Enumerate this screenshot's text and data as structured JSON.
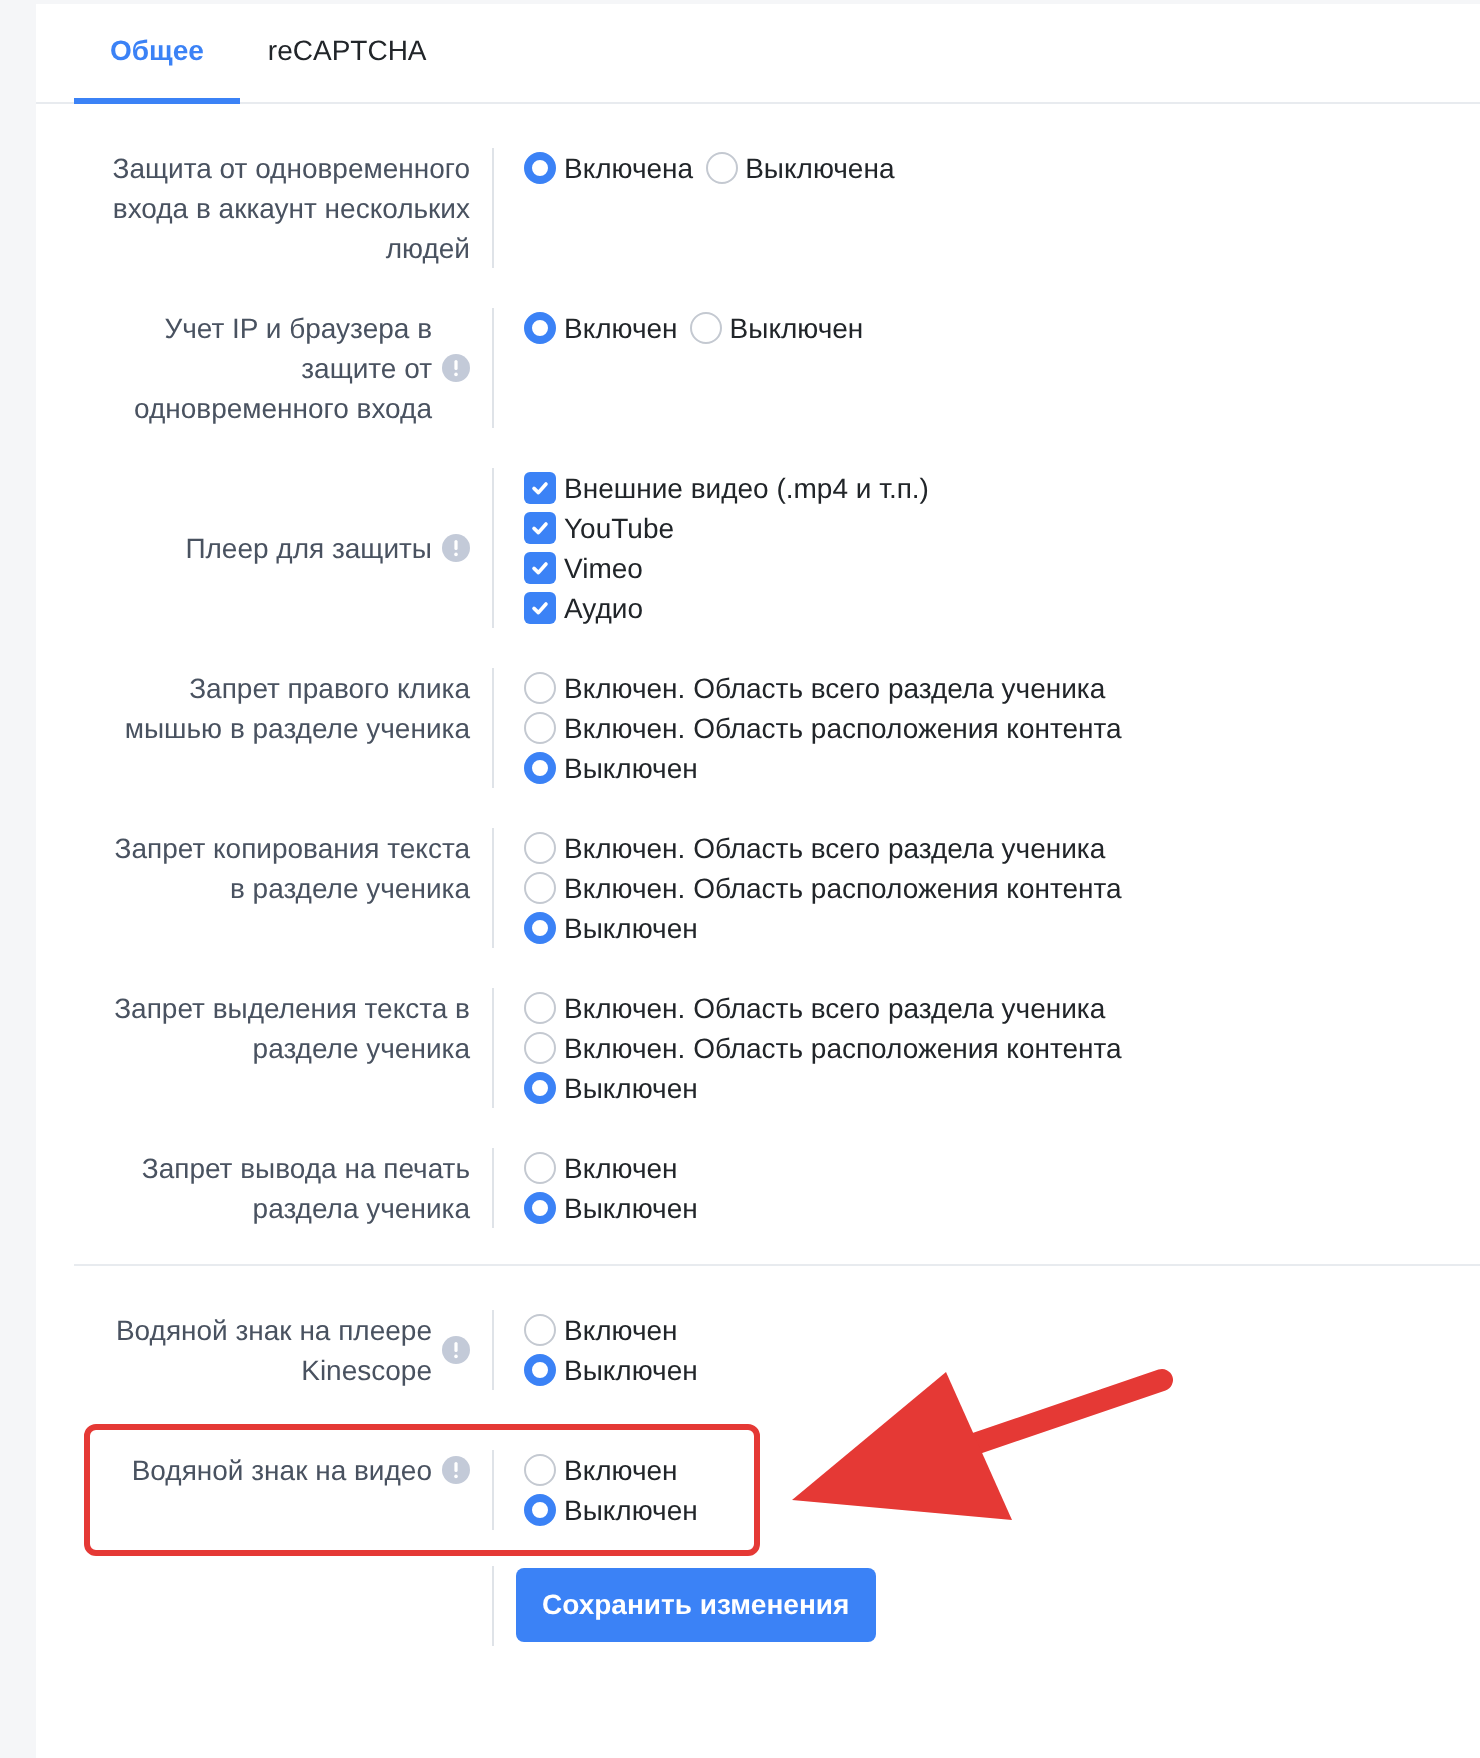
{
  "tabs": [
    {
      "label": "Общее",
      "selected": true
    },
    {
      "label": "reCAPTCHA",
      "selected": false
    }
  ],
  "sections": [
    {
      "rows": [
        {
          "label": "Защита от одновременного входа в аккаунт нескольких людей",
          "info": false,
          "kind": "radio",
          "inline": true,
          "highlighted": false,
          "options": [
            {
              "label": "Включена",
              "selected": true
            },
            {
              "label": "Выключена",
              "selected": false
            }
          ]
        },
        {
          "label": "Учет IP и браузера в защите от одновременного входа",
          "info": true,
          "kind": "radio",
          "inline": true,
          "highlighted": false,
          "options": [
            {
              "label": "Включен",
              "selected": true
            },
            {
              "label": "Выключен",
              "selected": false
            }
          ]
        },
        {
          "label": "Плеер для защиты",
          "info": true,
          "kind": "checkbox",
          "inline": false,
          "highlighted": false,
          "options": [
            {
              "label": "Внешние видео (.mp4 и т.п.)",
              "checked": true
            },
            {
              "label": "YouTube",
              "checked": true
            },
            {
              "label": "Vimeo",
              "checked": true
            },
            {
              "label": "Аудио",
              "checked": true
            }
          ]
        },
        {
          "label": "Запрет правого клика мышью в разделе ученика",
          "info": false,
          "kind": "radio",
          "inline": false,
          "highlighted": false,
          "options": [
            {
              "label": "Включен. Область всего раздела ученика",
              "selected": false
            },
            {
              "label": "Включен. Область расположения контента",
              "selected": false
            },
            {
              "label": "Выключен",
              "selected": true
            }
          ]
        },
        {
          "label": "Запрет копирования текста в разделе ученика",
          "info": false,
          "kind": "radio",
          "inline": false,
          "highlighted": false,
          "options": [
            {
              "label": "Включен. Область всего раздела ученика",
              "selected": false
            },
            {
              "label": "Включен. Область расположения контента",
              "selected": false
            },
            {
              "label": "Выключен",
              "selected": true
            }
          ]
        },
        {
          "label": "Запрет выделения текста в разделе ученика",
          "info": false,
          "kind": "radio",
          "inline": false,
          "highlighted": false,
          "options": [
            {
              "label": "Включен. Область всего раздела ученика",
              "selected": false
            },
            {
              "label": "Включен. Область расположения контента",
              "selected": false
            },
            {
              "label": "Выключен",
              "selected": true
            }
          ]
        },
        {
          "label": "Запрет вывода на печать раздела ученика",
          "info": false,
          "kind": "radio",
          "inline": false,
          "highlighted": false,
          "options": [
            {
              "label": "Включен",
              "selected": false
            },
            {
              "label": "Выключен",
              "selected": true
            }
          ]
        }
      ]
    },
    {
      "rows": [
        {
          "label": "Водяной знак на плеере Kinescope",
          "info": true,
          "kind": "radio",
          "inline": false,
          "highlighted": false,
          "options": [
            {
              "label": "Включен",
              "selected": false
            },
            {
              "label": "Выключен",
              "selected": true
            }
          ]
        },
        {
          "label": "Водяной знак на видео",
          "info": true,
          "kind": "radio",
          "inline": false,
          "highlighted": true,
          "options": [
            {
              "label": "Включен",
              "selected": false
            },
            {
              "label": "Выключен",
              "selected": true
            }
          ]
        }
      ]
    }
  ],
  "save_button": "Сохранить изменения"
}
